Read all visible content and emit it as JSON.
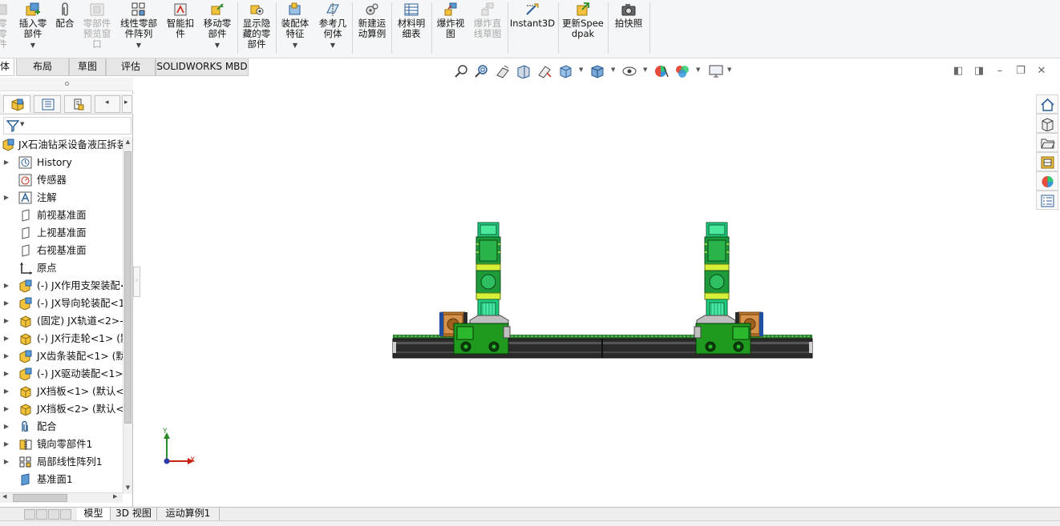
{
  "ribbon": {
    "buttons": [
      {
        "label": "零零件",
        "icon": "component-icon",
        "disabled": true
      },
      {
        "label": "插入零部件",
        "icon": "insert-component-icon",
        "dropdown": true
      },
      {
        "label": "配合",
        "icon": "mate-paperclip-icon"
      },
      {
        "label": "零部件预览窗口",
        "icon": "component-preview-icon",
        "disabled": true
      },
      {
        "label": "线性零部件阵列",
        "icon": "linear-pattern-icon",
        "dropdown": true
      },
      {
        "label": "智能扣件",
        "icon": "smart-fastener-icon"
      },
      {
        "label": "移动零部件",
        "icon": "move-component-icon",
        "dropdown": true
      },
      {
        "label": "显示隐藏的零部件",
        "icon": "show-hidden-icon"
      },
      {
        "label": "装配体特征",
        "icon": "assembly-feature-icon",
        "dropdown": true
      },
      {
        "label": "参考几何体",
        "icon": "reference-geometry-icon",
        "dropdown": true
      },
      {
        "label": "新建运动算例",
        "icon": "motion-study-icon"
      },
      {
        "label": "材料明细表",
        "icon": "bom-icon"
      },
      {
        "label": "爆炸视图",
        "icon": "explode-view-icon"
      },
      {
        "label": "爆炸直线草图",
        "icon": "explode-line-icon",
        "disabled": true
      },
      {
        "label": "Instant3D",
        "icon": "instant3d-icon"
      },
      {
        "label": "更新Speedpak",
        "icon": "speedpak-icon"
      },
      {
        "label": "拍快照",
        "icon": "camera-icon"
      }
    ]
  },
  "command_tabs": [
    "体",
    "布局",
    "草图",
    "评估",
    "SOLIDWORKS MBD"
  ],
  "tree": {
    "root": "JX石油钻采设备液压拆装",
    "items": [
      {
        "label": "History",
        "icon": "history-icon",
        "expandable": true
      },
      {
        "label": "传感器",
        "icon": "sensor-icon",
        "expandable": false
      },
      {
        "label": "注解",
        "icon": "annotation-icon",
        "expandable": true
      },
      {
        "label": "前视基准面",
        "icon": "plane-icon",
        "expandable": false
      },
      {
        "label": "上视基准面",
        "icon": "plane-icon",
        "expandable": false
      },
      {
        "label": "右视基准面",
        "icon": "plane-icon",
        "expandable": false
      },
      {
        "label": "原点",
        "icon": "origin-icon",
        "expandable": false
      },
      {
        "label": "(-) JX作用支架装配<",
        "icon": "subassembly-icon",
        "expandable": true
      },
      {
        "label": "(-) JX导向轮装配<1",
        "icon": "subassembly-icon",
        "expandable": true
      },
      {
        "label": "(固定) JX轨道<2>-",
        "icon": "part-icon",
        "expandable": true
      },
      {
        "label": "(-) JX行走轮<1> (默",
        "icon": "part-icon",
        "expandable": true
      },
      {
        "label": "JX齿条装配<1> (默",
        "icon": "subassembly-icon",
        "expandable": true
      },
      {
        "label": "(-) JX驱动装配<1>",
        "icon": "subassembly-icon",
        "expandable": true
      },
      {
        "label": "JX挡板<1> (默认<",
        "icon": "part-icon",
        "expandable": true
      },
      {
        "label": "JX挡板<2> (默认<",
        "icon": "part-icon",
        "expandable": true
      },
      {
        "label": "配合",
        "icon": "mates-icon",
        "expandable": true
      },
      {
        "label": "镜向零部件1",
        "icon": "mirror-component-icon",
        "expandable": true
      },
      {
        "label": "局部线性阵列1",
        "icon": "local-pattern-icon",
        "expandable": true
      },
      {
        "label": "基准面1",
        "icon": "plane1-icon",
        "expandable": false
      }
    ]
  },
  "bottom_tabs": [
    "模型",
    "3D 视图",
    "运动算例1"
  ],
  "triad": {
    "x": "X",
    "y": "Y"
  }
}
